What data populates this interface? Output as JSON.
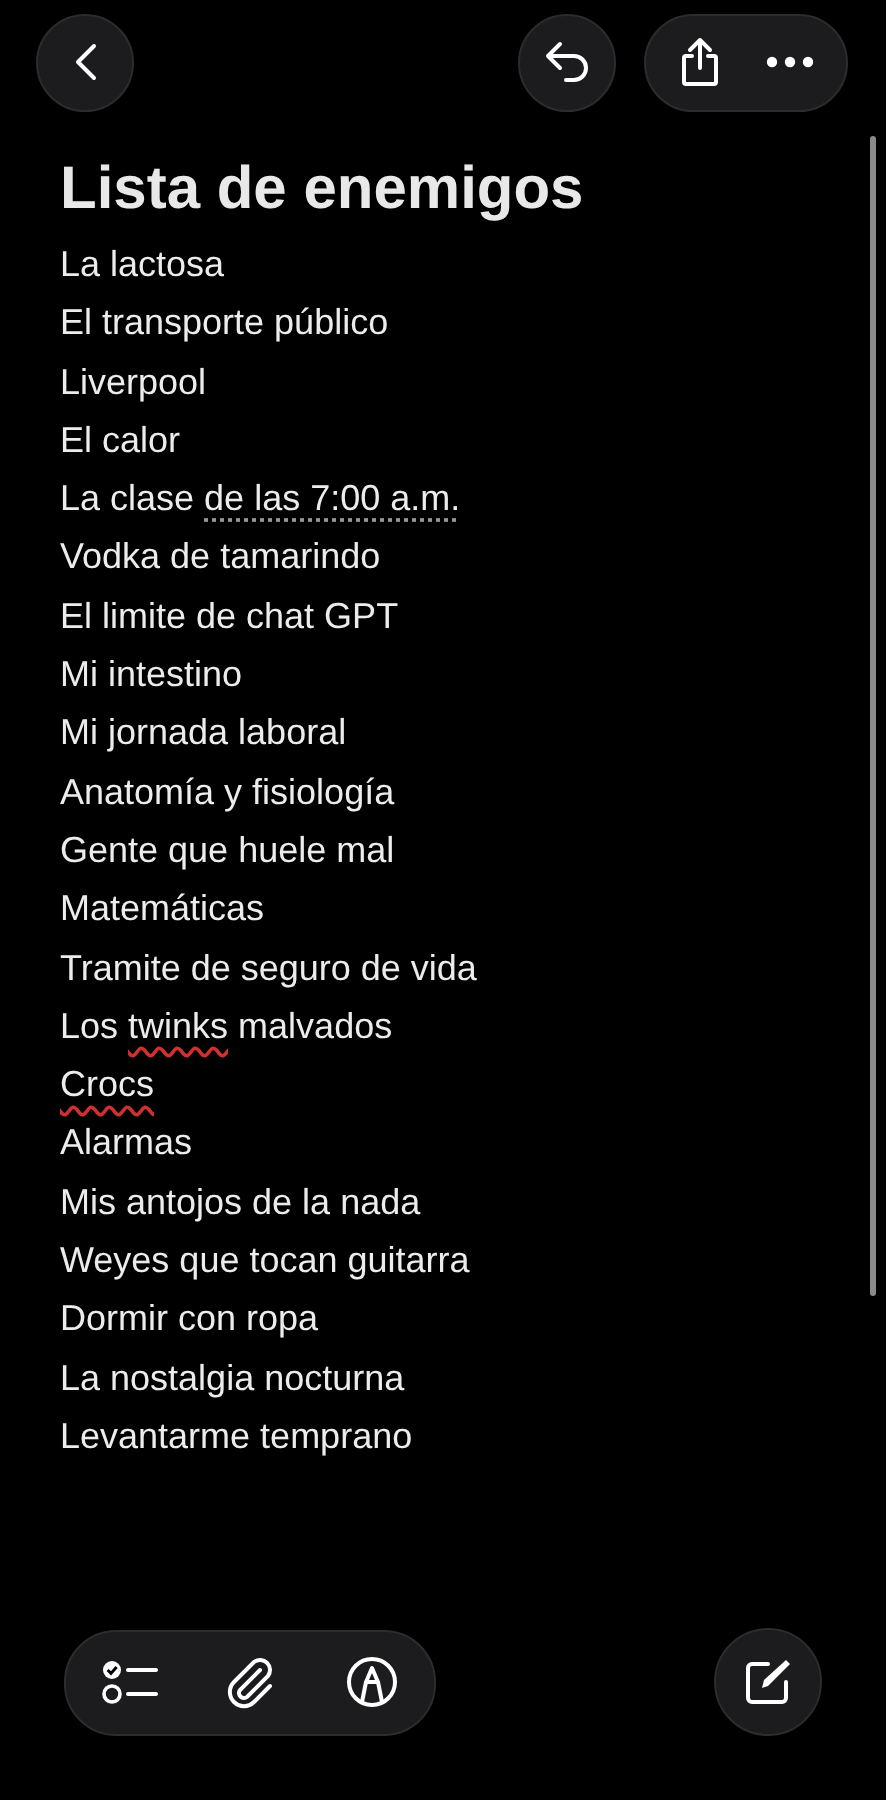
{
  "title": "Lista de enemigos",
  "lines": [
    {
      "text": "La lactosa"
    },
    {
      "text": "El transporte público"
    },
    {
      "text": "Liverpool"
    },
    {
      "text": "El calor"
    },
    {
      "parts": [
        {
          "text": "La clase "
        },
        {
          "text": "de las 7:00 a.m.",
          "kind": "detected"
        }
      ]
    },
    {
      "text": "Vodka de tamarindo"
    },
    {
      "text": "El limite de chat GPT"
    },
    {
      "text": "Mi intestino"
    },
    {
      "text": "Mi jornada laboral"
    },
    {
      "text": "Anatomía y fisiología"
    },
    {
      "text": "Gente que huele mal"
    },
    {
      "text": "Matemáticas"
    },
    {
      "text": "Tramite de seguro de vida"
    },
    {
      "parts": [
        {
          "text": "Los "
        },
        {
          "text": "twinks",
          "kind": "spelling"
        },
        {
          "text": " malvados"
        }
      ]
    },
    {
      "parts": [
        {
          "text": "Crocs",
          "kind": "spelling"
        }
      ]
    },
    {
      "text": "Alarmas"
    },
    {
      "text": "Mis antojos de la nada"
    },
    {
      "text": "Weyes que tocan guitarra"
    },
    {
      "text": "Dormir con ropa"
    },
    {
      "text": "La nostalgia nocturna"
    },
    {
      "text": "Levantarme temprano"
    }
  ]
}
